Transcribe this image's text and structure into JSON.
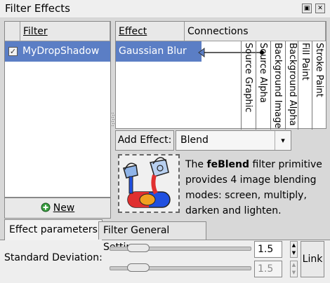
{
  "window": {
    "title": "Filter Effects",
    "button_restore": "▣",
    "button_close": "✕"
  },
  "filters": {
    "column_header": "Filter",
    "items": [
      {
        "name": "MyDropShadow",
        "checked": true
      }
    ],
    "check_mark": "✓",
    "new_button_label": "New"
  },
  "effects": {
    "column_effect": "Effect",
    "column_connections": "Connections",
    "items": [
      {
        "name": "Gaussian Blur"
      }
    ],
    "connection_labels": [
      "Source Graphic",
      "Source Alpha",
      "Background Image",
      "Background Alpha",
      "Fill Paint",
      "Stroke Paint"
    ]
  },
  "add_effect": {
    "button_label": "Add Effect:",
    "selected": "Blend",
    "arrow": "▾"
  },
  "description": {
    "prefix": "The ",
    "primitive": "feBlend",
    "rest": " filter primitive provides 4 image blending modes: screen, multiply, darken and lighten."
  },
  "tabs": [
    {
      "label": "Effect parameters",
      "active": true
    },
    {
      "label": "Filter General Settings",
      "active": false
    }
  ],
  "parameters": {
    "label": "Standard Deviation:",
    "value_x": "1.5",
    "value_y": "1.5",
    "slider_fraction_x": 0.15,
    "slider_fraction_y": 0.15,
    "link_label": "Link"
  },
  "colors": {
    "selection": "#5b7ec5",
    "blend_red": "#e03030",
    "blend_blue": "#2050e0",
    "blend_orange": "#f0a020"
  }
}
